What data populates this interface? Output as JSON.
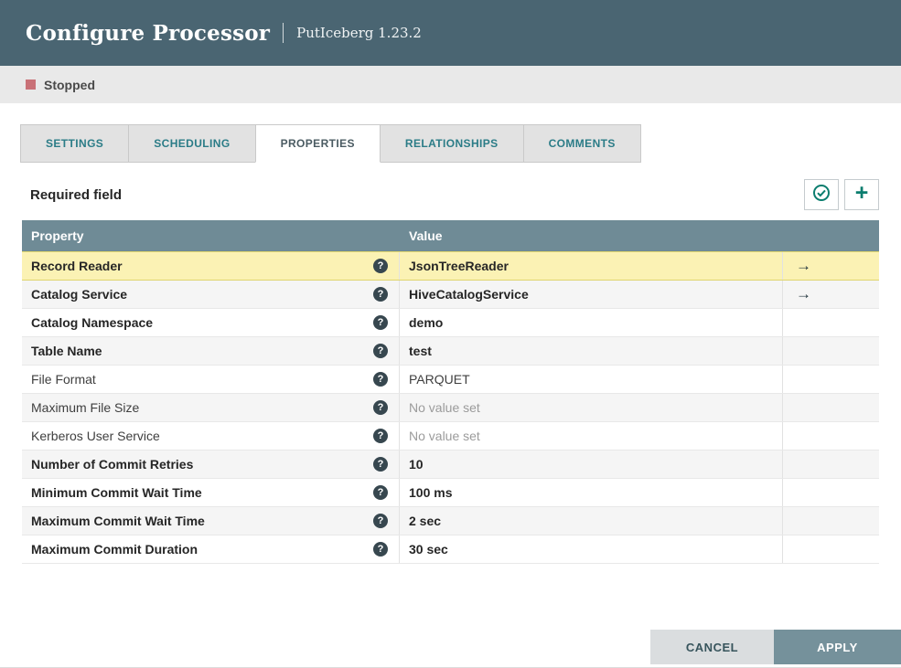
{
  "colors": {
    "header_bg": "#4a6572",
    "table_header_bg": "#6f8b96",
    "accent_teal": "#0b7d6e",
    "tab_text_teal": "#2b7c87",
    "highlight_yellow": "#fbf2b4",
    "stopped_red": "#c97177",
    "apply_button_bg": "#75919b"
  },
  "header": {
    "title": "Configure Processor",
    "subtitle": "PutIceberg 1.23.2"
  },
  "status": {
    "label": "Stopped"
  },
  "tabs": [
    {
      "label": "SETTINGS"
    },
    {
      "label": "SCHEDULING"
    },
    {
      "label": "PROPERTIES"
    },
    {
      "label": "RELATIONSHIPS"
    },
    {
      "label": "COMMENTS"
    }
  ],
  "active_tab": "PROPERTIES",
  "toolbar": {
    "required_label": "Required field",
    "verify_icon": "check-circle-icon",
    "add_icon": "plus-icon"
  },
  "icons": {
    "help_glyph": "?",
    "goto_glyph": "→",
    "plus_glyph": "+"
  },
  "table": {
    "header": {
      "property": "Property",
      "value": "Value"
    },
    "rows": [
      {
        "property": "Record Reader",
        "value": "JsonTreeReader",
        "bold": true,
        "highlighted": true,
        "has_goto": true,
        "no_value": false
      },
      {
        "property": "Catalog Service",
        "value": "HiveCatalogService",
        "bold": true,
        "highlighted": false,
        "has_goto": true,
        "no_value": false
      },
      {
        "property": "Catalog Namespace",
        "value": "demo",
        "bold": true,
        "highlighted": false,
        "has_goto": false,
        "no_value": false
      },
      {
        "property": "Table Name",
        "value": "test",
        "bold": true,
        "highlighted": false,
        "has_goto": false,
        "no_value": false
      },
      {
        "property": "File Format",
        "value": "PARQUET",
        "bold": false,
        "highlighted": false,
        "has_goto": false,
        "no_value": false
      },
      {
        "property": "Maximum File Size",
        "value": "No value set",
        "bold": false,
        "highlighted": false,
        "has_goto": false,
        "no_value": true
      },
      {
        "property": "Kerberos User Service",
        "value": "No value set",
        "bold": false,
        "highlighted": false,
        "has_goto": false,
        "no_value": true
      },
      {
        "property": "Number of Commit Retries",
        "value": "10",
        "bold": true,
        "highlighted": false,
        "has_goto": false,
        "no_value": false
      },
      {
        "property": "Minimum Commit Wait Time",
        "value": "100 ms",
        "bold": true,
        "highlighted": false,
        "has_goto": false,
        "no_value": false
      },
      {
        "property": "Maximum Commit Wait Time",
        "value": "2 sec",
        "bold": true,
        "highlighted": false,
        "has_goto": false,
        "no_value": false
      },
      {
        "property": "Maximum Commit Duration",
        "value": "30 sec",
        "bold": true,
        "highlighted": false,
        "has_goto": false,
        "no_value": false
      }
    ]
  },
  "footer": {
    "cancel_label": "CANCEL",
    "apply_label": "APPLY"
  }
}
